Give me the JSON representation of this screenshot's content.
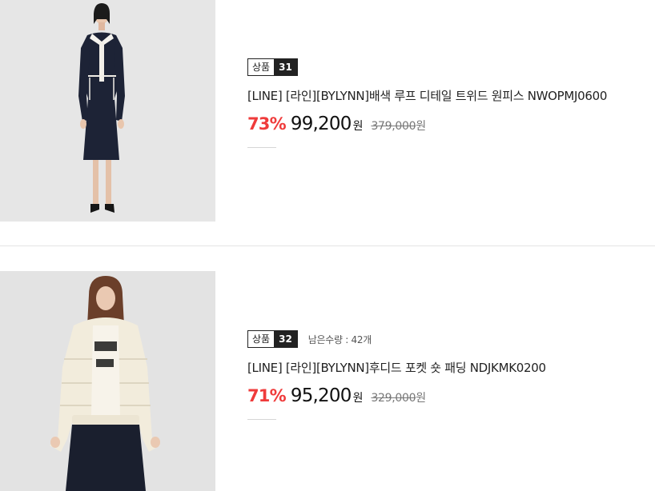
{
  "products": [
    {
      "badge_label": "상품",
      "badge_number": "31",
      "stock_text": "",
      "name": "[LINE] [라인][BYLYNN]배색 루프 디테일 트위드 원피스 NWOPMJ0600",
      "discount": "73%",
      "price": "99,200",
      "currency": "원",
      "original_price": "379,000",
      "image_icon": "model-tweed-dress-image"
    },
    {
      "badge_label": "상품",
      "badge_number": "32",
      "stock_text": "남은수량 : 42개",
      "name": "[LINE] [라인][BYLYNN]후디드 포켓 숏 패딩 NDJKMK0200",
      "discount": "71%",
      "price": "95,200",
      "currency": "원",
      "original_price": "329,000",
      "image_icon": "model-padded-jacket-image"
    }
  ],
  "colors": {
    "discount": "#ef3b3b",
    "badge_dark": "#222222",
    "image_bg_1": "#e6e6e6",
    "image_bg_2": "#e3e3e3"
  }
}
